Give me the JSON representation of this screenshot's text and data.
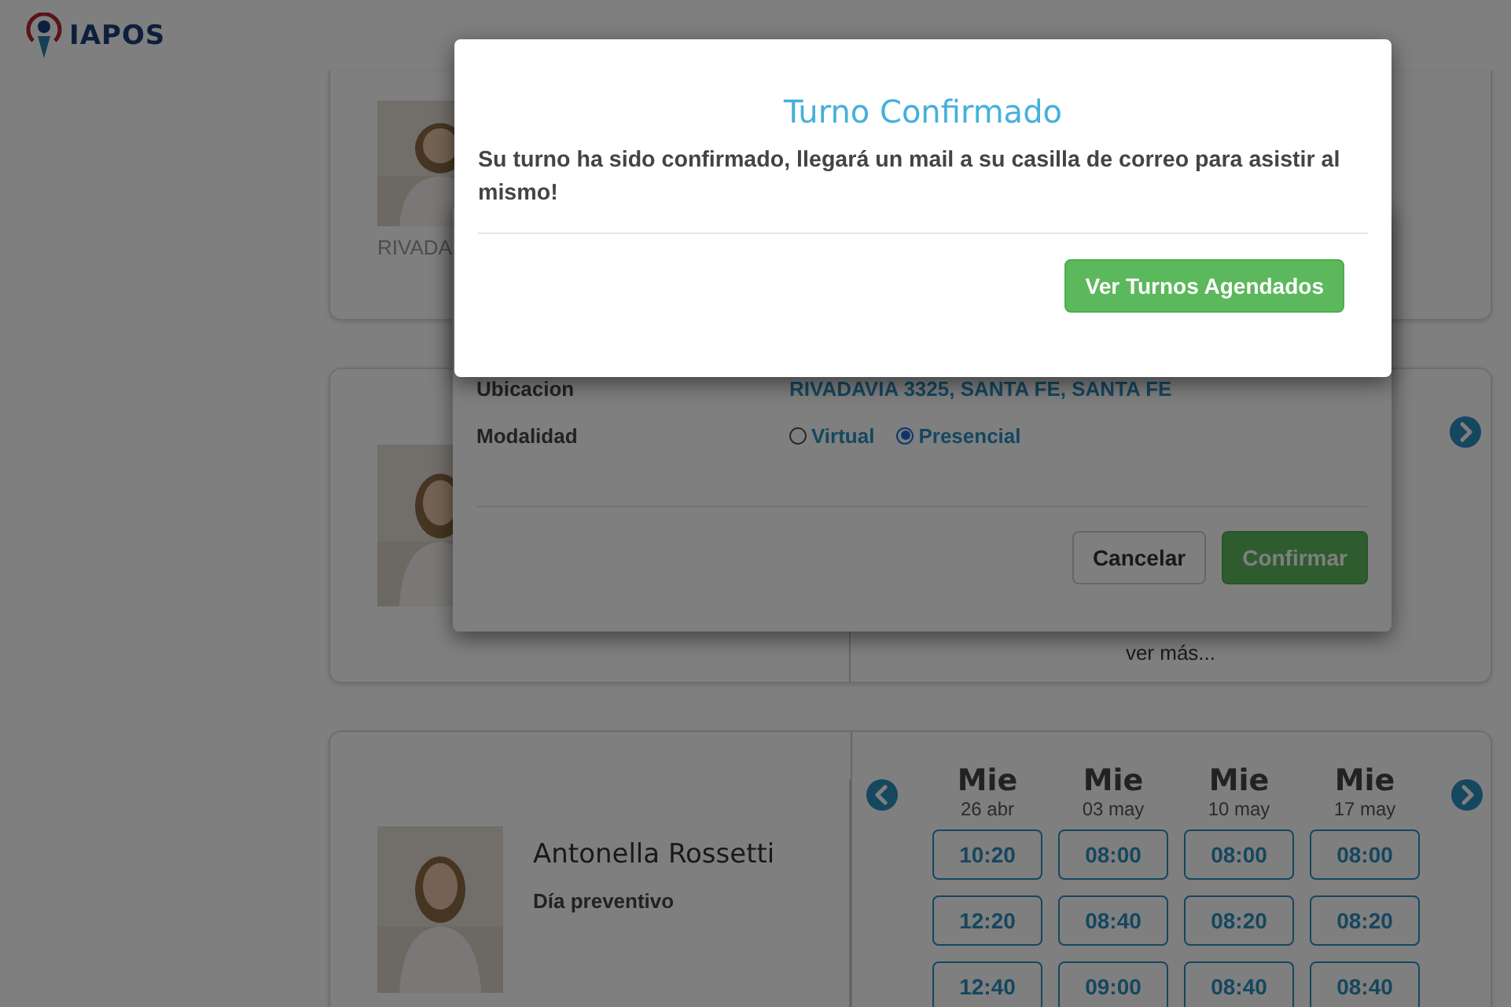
{
  "header": {
    "logo_text": "IAPOS"
  },
  "cards": [
    {
      "location": "RIVADA",
      "prev_arrow": false,
      "next_arrow": false
    },
    {
      "prev_arrow": false,
      "next_arrow": true,
      "more_link": "ver más..."
    },
    {
      "name": "Antonella Rossetti",
      "specialty": "Día preventivo",
      "prev_arrow": true,
      "next_arrow": true,
      "days": [
        {
          "weekday": "Mie",
          "date": "26 abr",
          "slots": [
            "10:20",
            "12:20",
            "12:40"
          ]
        },
        {
          "weekday": "Mie",
          "date": "03 may",
          "slots": [
            "08:00",
            "08:40",
            "09:00"
          ]
        },
        {
          "weekday": "Mie",
          "date": "10 may",
          "slots": [
            "08:00",
            "08:20",
            "08:40"
          ]
        },
        {
          "weekday": "Mie",
          "date": "17 may",
          "slots": [
            "08:00",
            "08:20",
            "08:40"
          ]
        }
      ]
    }
  ],
  "confirm_dialog": {
    "fields": [
      {
        "label": "Ubicacion",
        "value": "RIVADAVIA 3325, SANTA FE, SANTA FE"
      }
    ],
    "modalidad": {
      "label": "Modalidad",
      "options": [
        {
          "label": "Virtual",
          "selected": false
        },
        {
          "label": "Presencial",
          "selected": true
        }
      ]
    },
    "buttons": [
      {
        "label": "Cancelar",
        "kind": "secondary"
      },
      {
        "label": "Confirmar",
        "kind": "primary"
      }
    ]
  },
  "success_dialog": {
    "title": "Turno Confirmado",
    "message": "Su turno ha sido confirmado, llegará un mail a su casilla de correo para asistir al mismo!",
    "button": "Ver Turnos Agendados"
  }
}
